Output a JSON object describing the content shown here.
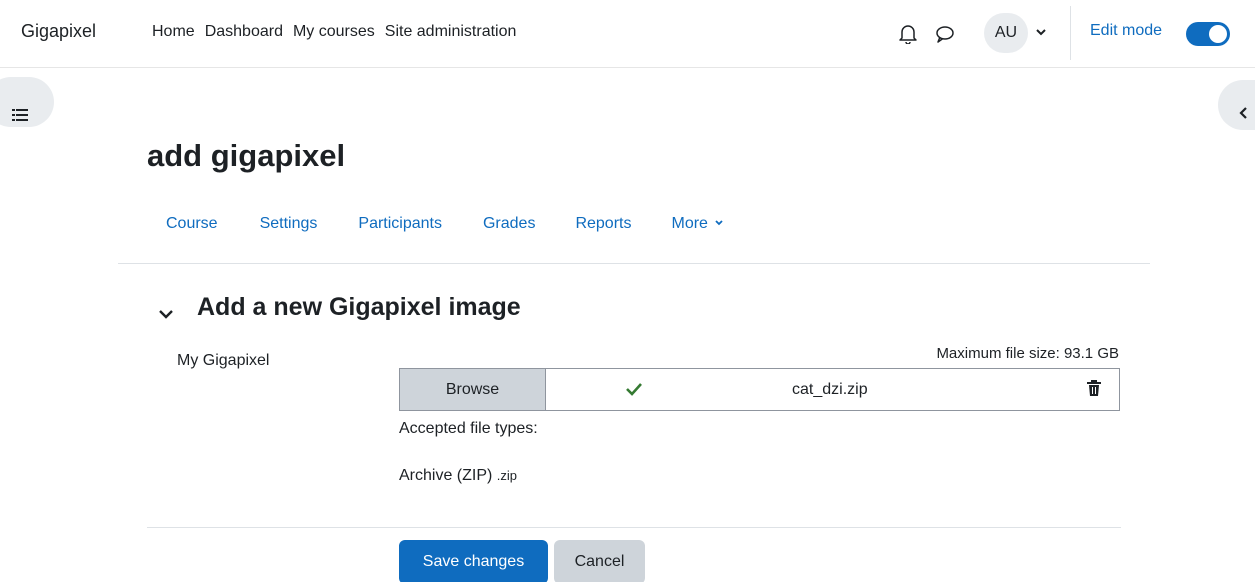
{
  "navbar": {
    "brand": "Gigapixel",
    "links": [
      "Home",
      "Dashboard",
      "My courses",
      "Site administration"
    ],
    "avatar_initials": "AU",
    "edit_mode_label": "Edit mode",
    "edit_mode_on": true
  },
  "page": {
    "title": "add gigapixel"
  },
  "secondary_nav": {
    "tabs": [
      "Course",
      "Settings",
      "Participants",
      "Grades",
      "Reports",
      "More"
    ]
  },
  "section": {
    "title": "Add a new Gigapixel image"
  },
  "form": {
    "field_label": "My Gigapixel",
    "max_size": "Maximum file size: 93.1 GB",
    "browse_label": "Browse",
    "file_name": "cat_dzi.zip",
    "accepted_label": "Accepted file types:",
    "accepted_type": "Archive (ZIP)",
    "accepted_ext": ".zip",
    "save_label": "Save changes",
    "cancel_label": "Cancel"
  },
  "colors": {
    "primary": "#0f6cbf",
    "success": "#357a32",
    "secondary_button": "#ced4da"
  },
  "icons": [
    "bell-icon",
    "chat-icon",
    "chevron-down-icon",
    "list-icon",
    "chevron-left-icon",
    "check-icon",
    "trash-icon"
  ]
}
